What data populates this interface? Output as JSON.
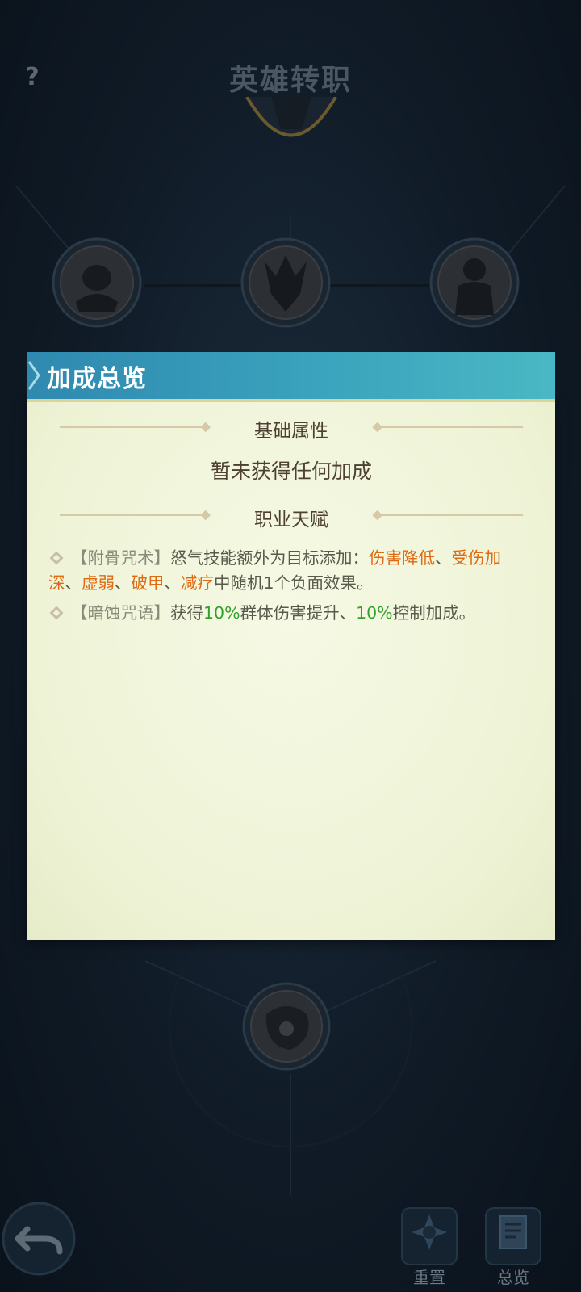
{
  "header": {
    "title": "英雄转职",
    "help_icon": "?"
  },
  "panel": {
    "title": "加成总览",
    "base_attr": {
      "title": "基础属性",
      "empty_text": "暂未获得任何加成"
    },
    "talent": {
      "title": "职业天赋",
      "items": [
        {
          "bracket_open": "【",
          "name": "附骨咒术",
          "bracket_close": "】",
          "text_a": "怒气技能额外为目标添加：",
          "d1": "伤害降低",
          "s1": "、",
          "d2": "受伤加深",
          "s2": "、",
          "d3": "虚弱",
          "s3": "、",
          "d4": "破甲",
          "s4": "、",
          "d5": "减疗",
          "text_b": "中随机1个负面效果。"
        },
        {
          "bracket_open": "【",
          "name": "暗蚀咒语",
          "bracket_close": "】",
          "text_a": "获得",
          "v1": "10%",
          "text_b": "群体伤害提升、",
          "v2": "10%",
          "text_c": "控制加成。"
        }
      ]
    }
  },
  "bottom_bar": {
    "reset_label": "重置",
    "overview_label": "总览"
  },
  "colors": {
    "accent_orange": "#e06a10",
    "accent_green": "#33a02c",
    "header_teal": "#3aa3bd"
  }
}
